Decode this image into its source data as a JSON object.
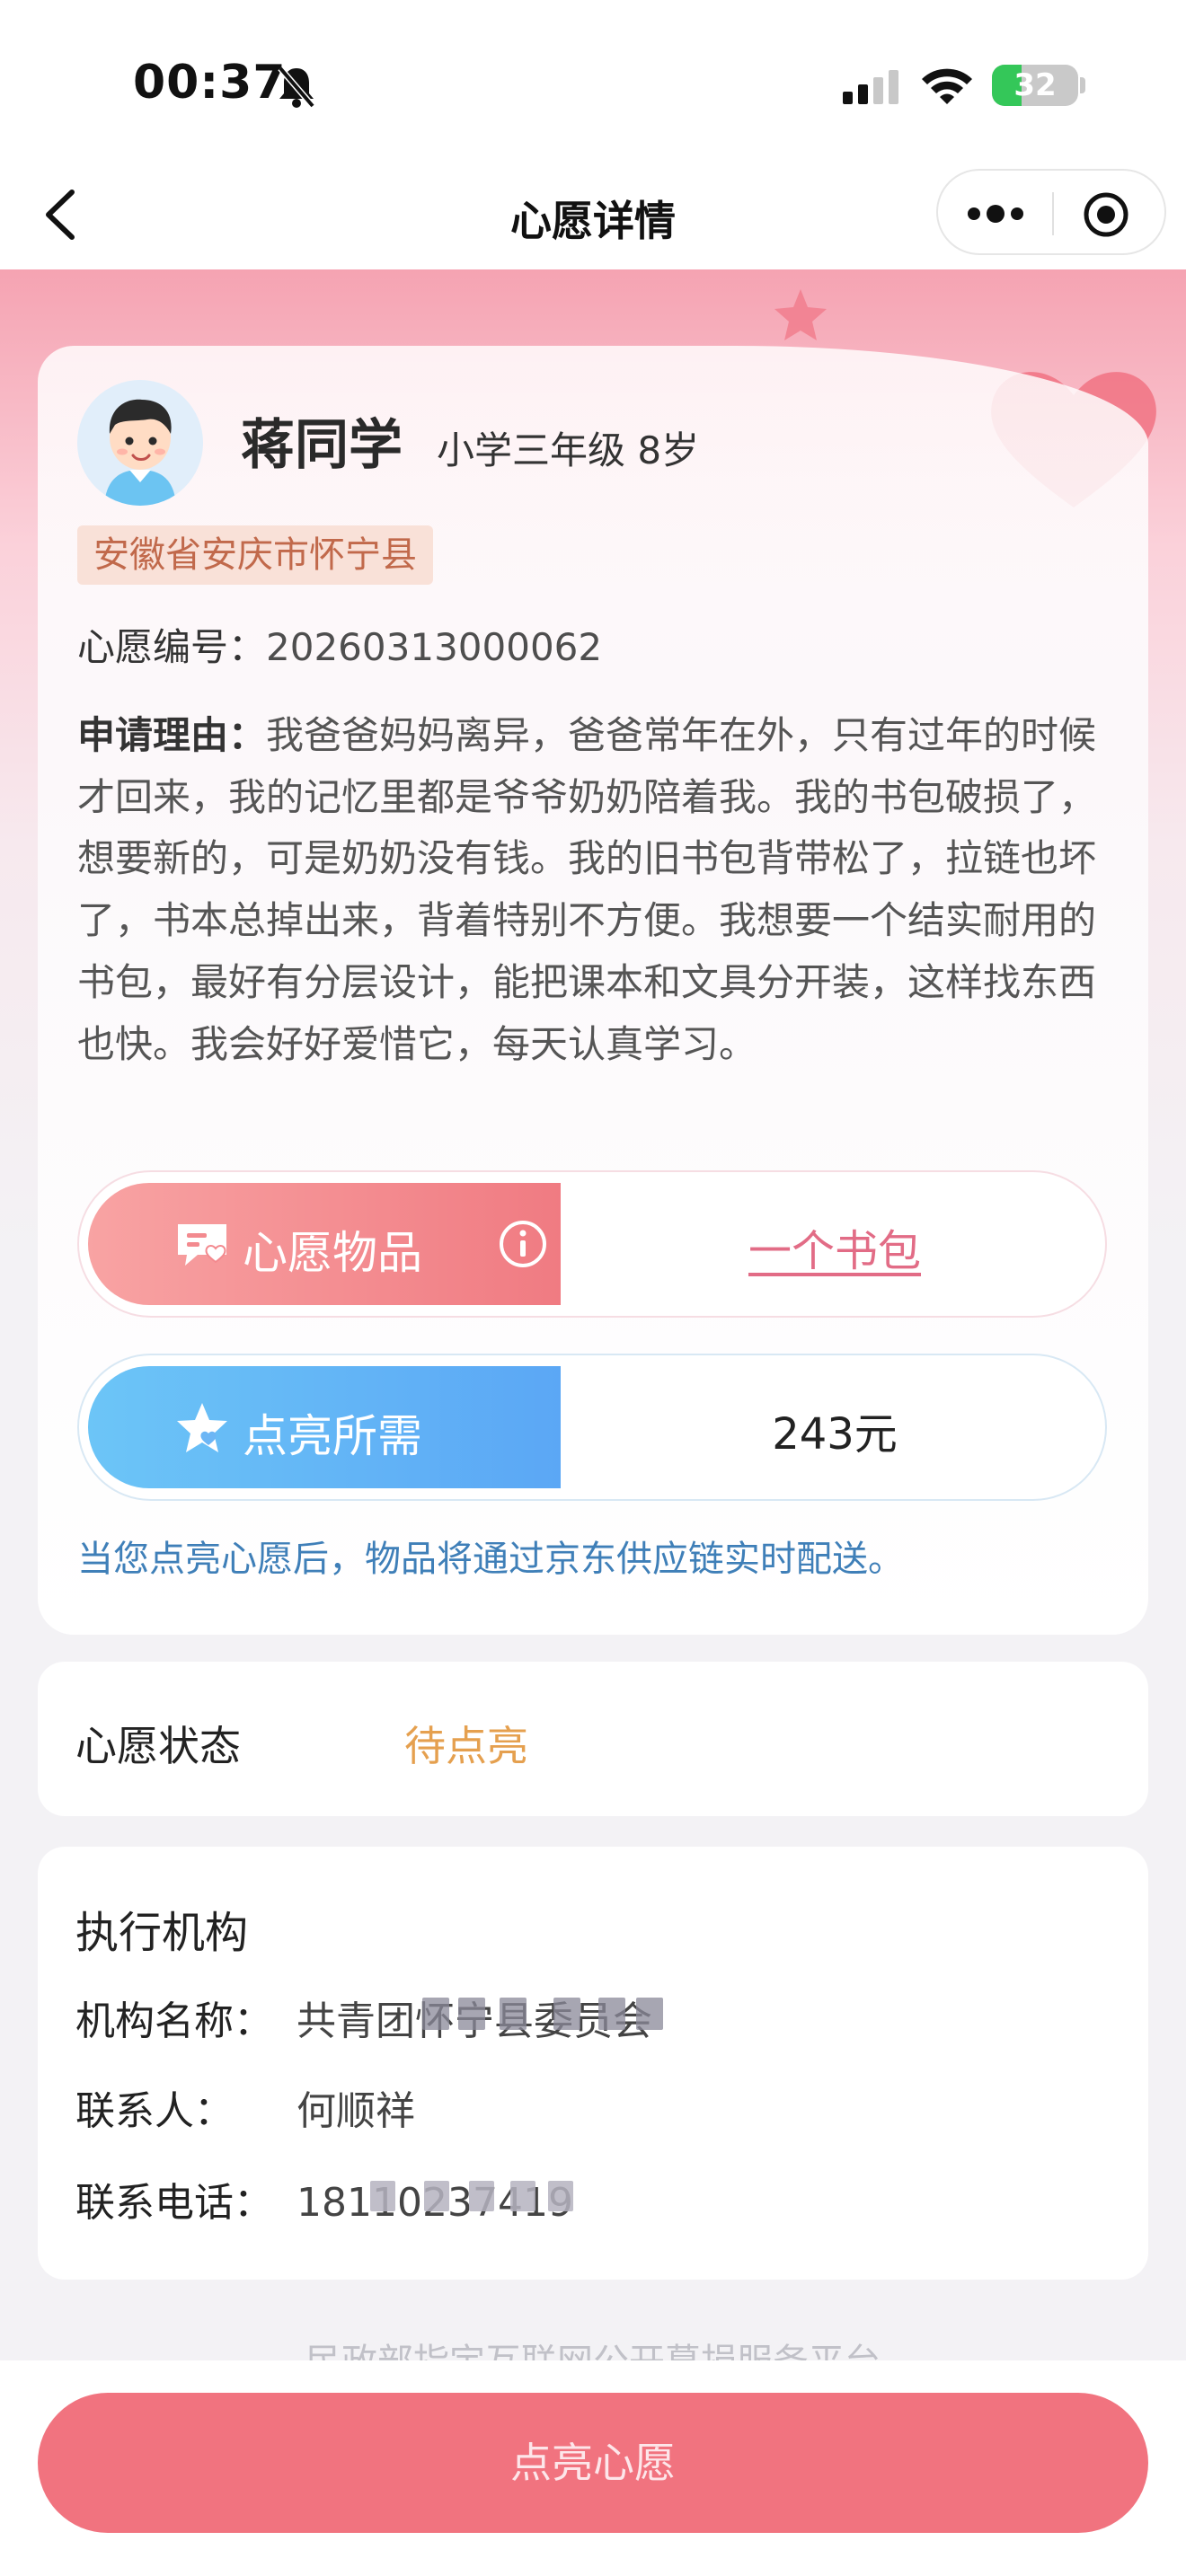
{
  "status_bar": {
    "time": "00:37",
    "battery": "32",
    "icons": [
      "bell-slash-icon",
      "cellular-signal-icon",
      "wifi-icon",
      "battery-icon"
    ]
  },
  "nav": {
    "title": "心愿详情",
    "icons": [
      "back-chevron-icon",
      "more-dots-icon",
      "target-circle-icon"
    ]
  },
  "child": {
    "name": "蒋同学",
    "meta": "小学三年级 8岁",
    "location": "安徽省安庆市怀宁县"
  },
  "wish": {
    "no_label": "心愿编号：",
    "no_value": "20260313000062",
    "reason_label": "申请理由：",
    "reason_text": "我爸爸妈妈离异，爸爸常年在外，只有过年的时候才回来，我的记忆里都是爷爷奶奶陪着我。我的书包破损了，想要新的，可是奶奶没有钱。我的旧书包背带松了，拉链也坏了，书本总掉出来，背着特别不方便。我想要一个结实耐用的书包，最好有分层设计，能把课本和文具分开装，这样找东西也快。我会好好爱惜它，每天认真学习。",
    "item_label": "心愿物品",
    "item_value": "一个书包",
    "cost_label": "点亮所需",
    "cost_value": "243元",
    "delivery_note": "当您点亮心愿后，物品将通过京东供应链实时配送。"
  },
  "status": {
    "label": "心愿状态",
    "value": "待点亮"
  },
  "org": {
    "title": "执行机构",
    "name_label": "机构名称：",
    "name_value": "共青团怀宁县委员会",
    "contact_label": "联系人：",
    "contact_value": "何顺祥",
    "phone_label": "联系电话：",
    "phone_value": "18110237419"
  },
  "footer": {
    "faint_text": "民政部指定互联网公开募捐服务平台",
    "cta_label": "点亮心愿"
  },
  "colors": {
    "accent_pink": "#f1737f",
    "pending_orange": "#e5a04f",
    "note_blue": "#3f7fb8",
    "item_link": "#e26c86"
  }
}
